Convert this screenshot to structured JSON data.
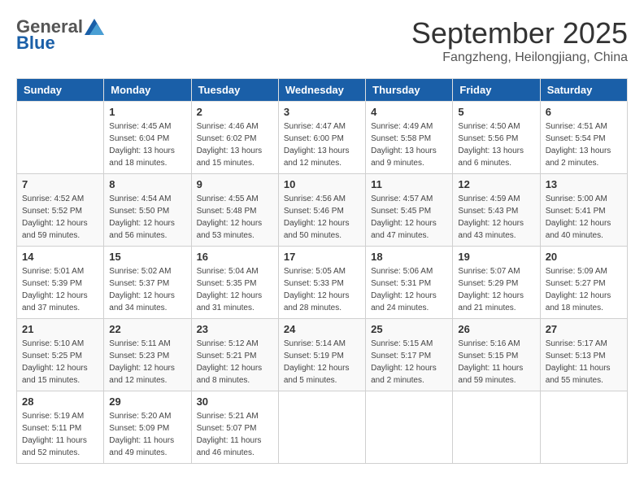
{
  "header": {
    "logo": {
      "general": "General",
      "blue": "Blue",
      "tagline": ""
    },
    "title": "September 2025",
    "location": "Fangzheng, Heilongjiang, China"
  },
  "weekdays": [
    "Sunday",
    "Monday",
    "Tuesday",
    "Wednesday",
    "Thursday",
    "Friday",
    "Saturday"
  ],
  "weeks": [
    [
      {
        "day": "",
        "sunrise": "",
        "sunset": "",
        "daylight": ""
      },
      {
        "day": "1",
        "sunrise": "Sunrise: 4:45 AM",
        "sunset": "Sunset: 6:04 PM",
        "daylight": "Daylight: 13 hours and 18 minutes."
      },
      {
        "day": "2",
        "sunrise": "Sunrise: 4:46 AM",
        "sunset": "Sunset: 6:02 PM",
        "daylight": "Daylight: 13 hours and 15 minutes."
      },
      {
        "day": "3",
        "sunrise": "Sunrise: 4:47 AM",
        "sunset": "Sunset: 6:00 PM",
        "daylight": "Daylight: 13 hours and 12 minutes."
      },
      {
        "day": "4",
        "sunrise": "Sunrise: 4:49 AM",
        "sunset": "Sunset: 5:58 PM",
        "daylight": "Daylight: 13 hours and 9 minutes."
      },
      {
        "day": "5",
        "sunrise": "Sunrise: 4:50 AM",
        "sunset": "Sunset: 5:56 PM",
        "daylight": "Daylight: 13 hours and 6 minutes."
      },
      {
        "day": "6",
        "sunrise": "Sunrise: 4:51 AM",
        "sunset": "Sunset: 5:54 PM",
        "daylight": "Daylight: 13 hours and 2 minutes."
      }
    ],
    [
      {
        "day": "7",
        "sunrise": "Sunrise: 4:52 AM",
        "sunset": "Sunset: 5:52 PM",
        "daylight": "Daylight: 12 hours and 59 minutes."
      },
      {
        "day": "8",
        "sunrise": "Sunrise: 4:54 AM",
        "sunset": "Sunset: 5:50 PM",
        "daylight": "Daylight: 12 hours and 56 minutes."
      },
      {
        "day": "9",
        "sunrise": "Sunrise: 4:55 AM",
        "sunset": "Sunset: 5:48 PM",
        "daylight": "Daylight: 12 hours and 53 minutes."
      },
      {
        "day": "10",
        "sunrise": "Sunrise: 4:56 AM",
        "sunset": "Sunset: 5:46 PM",
        "daylight": "Daylight: 12 hours and 50 minutes."
      },
      {
        "day": "11",
        "sunrise": "Sunrise: 4:57 AM",
        "sunset": "Sunset: 5:45 PM",
        "daylight": "Daylight: 12 hours and 47 minutes."
      },
      {
        "day": "12",
        "sunrise": "Sunrise: 4:59 AM",
        "sunset": "Sunset: 5:43 PM",
        "daylight": "Daylight: 12 hours and 43 minutes."
      },
      {
        "day": "13",
        "sunrise": "Sunrise: 5:00 AM",
        "sunset": "Sunset: 5:41 PM",
        "daylight": "Daylight: 12 hours and 40 minutes."
      }
    ],
    [
      {
        "day": "14",
        "sunrise": "Sunrise: 5:01 AM",
        "sunset": "Sunset: 5:39 PM",
        "daylight": "Daylight: 12 hours and 37 minutes."
      },
      {
        "day": "15",
        "sunrise": "Sunrise: 5:02 AM",
        "sunset": "Sunset: 5:37 PM",
        "daylight": "Daylight: 12 hours and 34 minutes."
      },
      {
        "day": "16",
        "sunrise": "Sunrise: 5:04 AM",
        "sunset": "Sunset: 5:35 PM",
        "daylight": "Daylight: 12 hours and 31 minutes."
      },
      {
        "day": "17",
        "sunrise": "Sunrise: 5:05 AM",
        "sunset": "Sunset: 5:33 PM",
        "daylight": "Daylight: 12 hours and 28 minutes."
      },
      {
        "day": "18",
        "sunrise": "Sunrise: 5:06 AM",
        "sunset": "Sunset: 5:31 PM",
        "daylight": "Daylight: 12 hours and 24 minutes."
      },
      {
        "day": "19",
        "sunrise": "Sunrise: 5:07 AM",
        "sunset": "Sunset: 5:29 PM",
        "daylight": "Daylight: 12 hours and 21 minutes."
      },
      {
        "day": "20",
        "sunrise": "Sunrise: 5:09 AM",
        "sunset": "Sunset: 5:27 PM",
        "daylight": "Daylight: 12 hours and 18 minutes."
      }
    ],
    [
      {
        "day": "21",
        "sunrise": "Sunrise: 5:10 AM",
        "sunset": "Sunset: 5:25 PM",
        "daylight": "Daylight: 12 hours and 15 minutes."
      },
      {
        "day": "22",
        "sunrise": "Sunrise: 5:11 AM",
        "sunset": "Sunset: 5:23 PM",
        "daylight": "Daylight: 12 hours and 12 minutes."
      },
      {
        "day": "23",
        "sunrise": "Sunrise: 5:12 AM",
        "sunset": "Sunset: 5:21 PM",
        "daylight": "Daylight: 12 hours and 8 minutes."
      },
      {
        "day": "24",
        "sunrise": "Sunrise: 5:14 AM",
        "sunset": "Sunset: 5:19 PM",
        "daylight": "Daylight: 12 hours and 5 minutes."
      },
      {
        "day": "25",
        "sunrise": "Sunrise: 5:15 AM",
        "sunset": "Sunset: 5:17 PM",
        "daylight": "Daylight: 12 hours and 2 minutes."
      },
      {
        "day": "26",
        "sunrise": "Sunrise: 5:16 AM",
        "sunset": "Sunset: 5:15 PM",
        "daylight": "Daylight: 11 hours and 59 minutes."
      },
      {
        "day": "27",
        "sunrise": "Sunrise: 5:17 AM",
        "sunset": "Sunset: 5:13 PM",
        "daylight": "Daylight: 11 hours and 55 minutes."
      }
    ],
    [
      {
        "day": "28",
        "sunrise": "Sunrise: 5:19 AM",
        "sunset": "Sunset: 5:11 PM",
        "daylight": "Daylight: 11 hours and 52 minutes."
      },
      {
        "day": "29",
        "sunrise": "Sunrise: 5:20 AM",
        "sunset": "Sunset: 5:09 PM",
        "daylight": "Daylight: 11 hours and 49 minutes."
      },
      {
        "day": "30",
        "sunrise": "Sunrise: 5:21 AM",
        "sunset": "Sunset: 5:07 PM",
        "daylight": "Daylight: 11 hours and 46 minutes."
      },
      {
        "day": "",
        "sunrise": "",
        "sunset": "",
        "daylight": ""
      },
      {
        "day": "",
        "sunrise": "",
        "sunset": "",
        "daylight": ""
      },
      {
        "day": "",
        "sunrise": "",
        "sunset": "",
        "daylight": ""
      },
      {
        "day": "",
        "sunrise": "",
        "sunset": "",
        "daylight": ""
      }
    ]
  ]
}
